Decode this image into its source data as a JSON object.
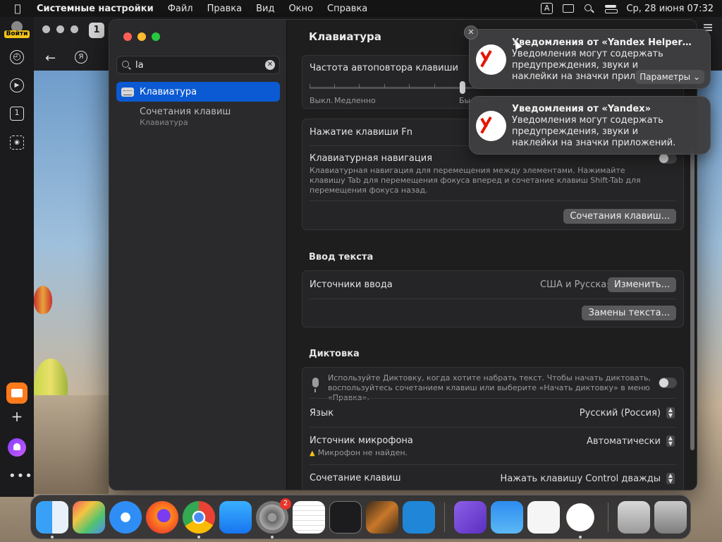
{
  "menubar": {
    "app_name": "Системные настройки",
    "items": [
      "Файл",
      "Правка",
      "Вид",
      "Окно",
      "Справка"
    ],
    "input_indicator": "A",
    "datetime": "Ср, 28 июня  07:32"
  },
  "browser": {
    "login_label": "Войти",
    "tab_count": "1",
    "ya_label": "Я",
    "sidebar_numbered_label": "1"
  },
  "settings": {
    "search_value": "la",
    "results": [
      {
        "label": "Клавиатура"
      },
      {
        "label": "Сочетания клавиш",
        "sublabel": "Клавиатура"
      }
    ],
    "title": "Клавиатура",
    "key_repeat": {
      "label": "Частота автоповтора клавиши",
      "left_labels": [
        "Выкл.",
        "Медленно"
      ],
      "right_label": "Быстро",
      "value_fraction": 0.95
    },
    "fn_key": {
      "label": "Нажатие клавиши Fn"
    },
    "keyboard_nav": {
      "label": "Клавиатурная навигация",
      "description": "Клавиатурная навигация для перемещения между элементами. Нажимайте клавишу Tab для перемещения фокуса вперед и сочетание клавиш Shift-Tab для перемещения фокуса назад.",
      "toggle_on": false
    },
    "shortcuts_button": "Сочетания клавиш...",
    "text_input": {
      "title": "Ввод текста",
      "sources_label": "Источники ввода",
      "sources_value": "США и Русская",
      "change_button": "Изменить...",
      "replacements_button": "Замены текста..."
    },
    "dictation": {
      "title": "Диктовка",
      "description": "Используйте Диктовку, когда хотите набрать текст. Чтобы начать диктовать, воспользуйтесь сочетанием клавиш или выберите «Начать диктовку» в меню «Правка».",
      "toggle_on": false,
      "language_label": "Язык",
      "language_value": "Русский (Россия)",
      "mic_label": "Источник микрофона",
      "mic_warning": "Микрофон не найден.",
      "mic_value": "Автоматически",
      "shortcut_label": "Сочетание клавиш",
      "shortcut_value": "Нажать клавишу Control дважды"
    }
  },
  "notifications": [
    {
      "title": "Уведомления от «Yandex Helper…",
      "body": "Уведомления могут содержать предупреждения, звуки и наклейки на значки приложений.",
      "options_label": "Параметры"
    },
    {
      "title": "Уведомления от «Yandex»",
      "body": "Уведомления могут содержать предупреждения, звуки и наклейки на значки приложений."
    }
  ],
  "dock": {
    "apps": [
      "finder-icon",
      "launchpad-icon",
      "safari-icon",
      "firefox-icon",
      "chrome-icon",
      "app-store-icon",
      "system-settings-icon",
      "textedit-icon",
      "terminal-icon",
      "garageband-icon",
      "vscode-icon",
      "visual-studio-icon",
      "weather-icon",
      "freeform-icon",
      "yandex-browser-icon",
      "downloads-icon",
      "trash-icon"
    ],
    "settings_badge": "2"
  },
  "colors": {
    "accent": "#0b5ad3",
    "yandex_red": "#e61400"
  }
}
